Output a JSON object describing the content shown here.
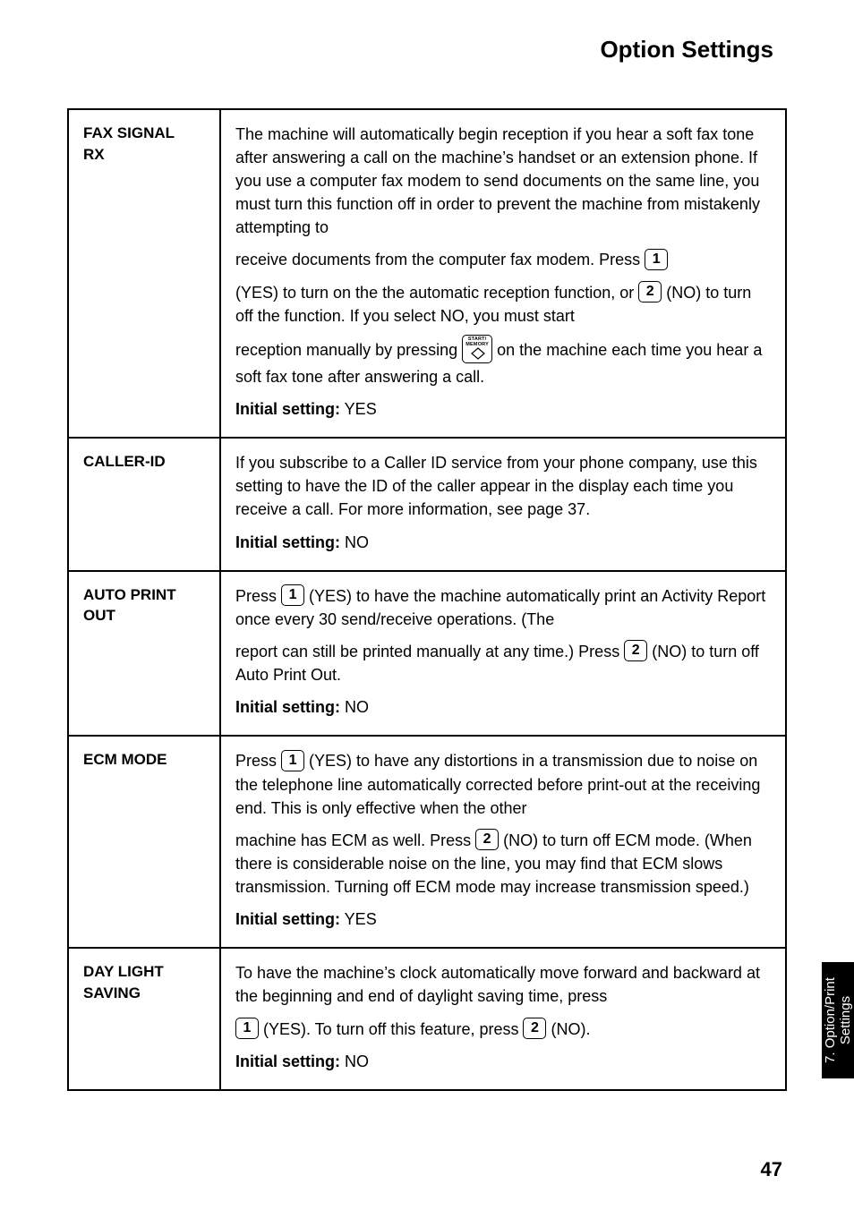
{
  "header": "Option Settings",
  "sidetab": {
    "line1": "7. Option/Print",
    "line2": "Settings"
  },
  "pagenum": "47",
  "rows": {
    "faxsignal": {
      "label_l1": "FAX SIGNAL",
      "label_l2": "RX",
      "p1": "The machine will automatically begin reception if you hear a soft fax tone after answering a call on the machine’s handset or an extension phone. If you use a computer fax modem to send documents on the same line, you must turn this function off in order to prevent the machine from mistakenly attempting to",
      "p2a": "receive documents from the computer fax modem.  Press ",
      "k1": "1",
      "p3a": "(YES) to turn on the the automatic reception function, or ",
      "k2": "2",
      "p3b": " (NO) to turn off the function. If you select NO, you must start",
      "p4a": "reception manually by pressing ",
      "start_top": "START/",
      "start_bottom": "MEMORY",
      "p4b": " on the machine each time you hear a soft fax tone after answering a call.",
      "init_lbl": "Initial setting:",
      "init_val": " YES"
    },
    "callerid": {
      "label": "CALLER-ID",
      "p1": "If you subscribe to a Caller ID service from your phone company, use this setting to have the ID of the caller appear in the display each time you receive a call. For more information, see page 37.",
      "init_lbl": "Initial setting:",
      "init_val": " NO"
    },
    "autoprint": {
      "label_l1": "AUTO PRINT",
      "label_l2": "OUT",
      "p1a": "Press ",
      "k1": "1",
      "p1b": " (YES) to have the machine automatically print an Activity Report once every 30 send/receive operations. (The",
      "p2a": "report can still be printed manually at any time.) Press ",
      "k2": "2",
      "p2b": " (NO) to turn off Auto Print Out.",
      "init_lbl": "Initial setting:",
      "init_val": " NO"
    },
    "ecm": {
      "label": "ECM MODE",
      "p1a": "Press ",
      "k1": "1",
      "p1b": " (YES) to have any distortions in a transmission due to noise on the telephone line automatically corrected before print-out at the receiving end. This is only effective when the other",
      "p2a": "machine has ECM as well. Press ",
      "k2": "2",
      "p2b": " (NO) to turn off ECM mode. (When there is considerable noise on the line, you may find that ECM slows transmission. Turning off ECM mode may increase transmission speed.)",
      "init_lbl": "Initial setting:",
      "init_val": " YES"
    },
    "daylight": {
      "label_l1": "DAY LIGHT",
      "label_l2": "SAVING",
      "p1": "To have the machine’s clock automatically move forward and backward at the beginning and end of daylight saving time, press",
      "k1": "1",
      "p2a": " (YES). To turn off this feature, press ",
      "k2": "2",
      "p2b": " (NO).",
      "init_lbl": "Initial setting:",
      "init_val": " NO"
    }
  }
}
